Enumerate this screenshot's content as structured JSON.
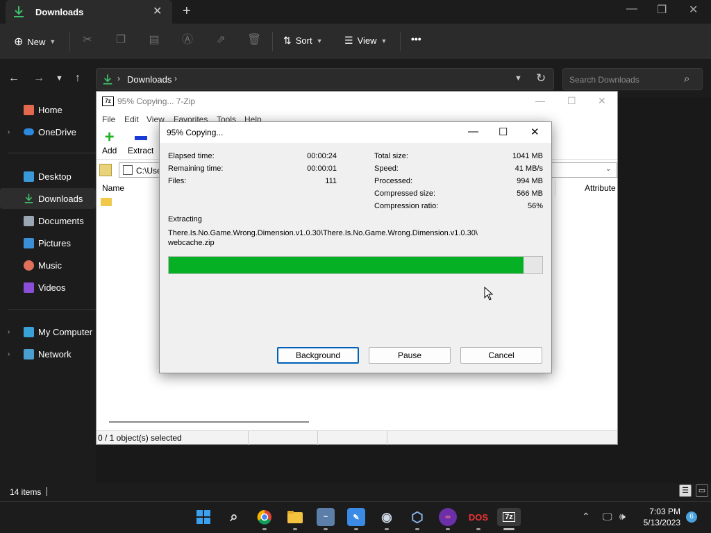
{
  "explorer": {
    "tab_title": "Downloads",
    "toolbar": {
      "new_label": "New",
      "sort_label": "Sort",
      "view_label": "View",
      "more_label": "•••"
    },
    "address": {
      "crumb": "Downloads"
    },
    "search": {
      "placeholder": "Search Downloads"
    },
    "sidebar": {
      "items": [
        {
          "label": "Home"
        },
        {
          "label": "OneDrive"
        },
        {
          "label": "Desktop"
        },
        {
          "label": "Downloads"
        },
        {
          "label": "Documents"
        },
        {
          "label": "Pictures"
        },
        {
          "label": "Music"
        },
        {
          "label": "Videos"
        },
        {
          "label": "My Computer"
        },
        {
          "label": "Network"
        }
      ]
    },
    "status": {
      "items_count": "14 items"
    }
  },
  "sevenzip": {
    "title": "95% Copying... 7-Zip",
    "app_icon": "7z",
    "menu": [
      "File",
      "Edit",
      "View",
      "Favorites",
      "Tools",
      "Help"
    ],
    "tools": {
      "add": "Add",
      "extract": "Extract"
    },
    "path": "C:\\Use",
    "columns": {
      "name": "Name",
      "attributes": "Attribute"
    },
    "status": "0 / 1 object(s) selected"
  },
  "progress": {
    "title": "95% Copying...",
    "left_stats": [
      {
        "label": "Elapsed time:",
        "value": "00:00:24"
      },
      {
        "label": "Remaining time:",
        "value": "00:00:01"
      },
      {
        "label": "Files:",
        "value": "111"
      }
    ],
    "right_stats": [
      {
        "label": "Total size:",
        "value": "1041 MB"
      },
      {
        "label": "Speed:",
        "value": "41 MB/s"
      },
      {
        "label": "Processed:",
        "value": "994 MB"
      },
      {
        "label": "Compressed size:",
        "value": "566 MB"
      },
      {
        "label": "Compression ratio:",
        "value": "56%"
      }
    ],
    "operation": "Extracting",
    "file_line1": "There.Is.No.Game.Wrong.Dimension.v1.0.30\\There.Is.No.Game.Wrong.Dimension.v1.0.30\\",
    "file_line2": "webcache.zip",
    "percent": 95,
    "buttons": {
      "background": "Background",
      "pause": "Pause",
      "cancel": "Cancel"
    }
  },
  "taskbar": {
    "time": "7:03 PM",
    "date": "5/13/2023",
    "notifications": "6",
    "apps": [
      "start-icon",
      "search-icon",
      "chrome-icon",
      "file-explorer-icon",
      "photo-viewer-icon",
      "paint-icon",
      "steam-icon",
      "virtualbox-icon",
      "infinity-app-icon",
      "dosbox-icon",
      "7zip-icon"
    ]
  },
  "colors": {
    "progress_green": "#06b025",
    "accent_blue": "#005fb8",
    "download_green": "#3fbf6a"
  }
}
